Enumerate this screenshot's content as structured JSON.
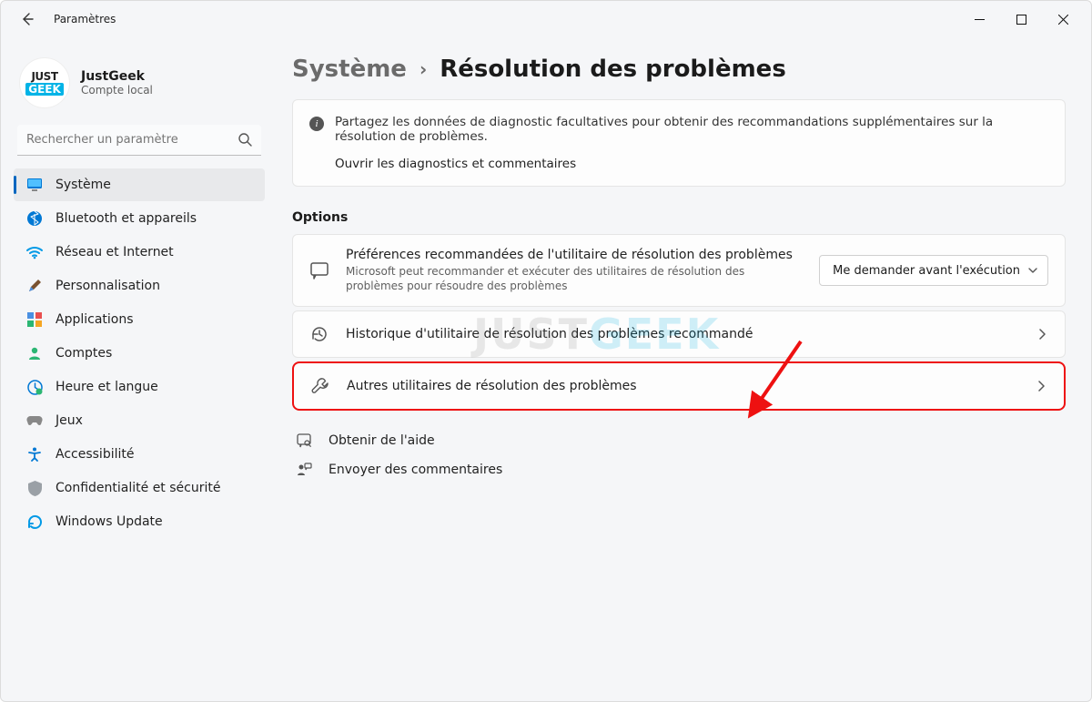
{
  "window": {
    "title": "Paramètres"
  },
  "user": {
    "name": "JustGeek",
    "subtitle": "Compte local",
    "avatar_line1": "JUST",
    "avatar_line2": "GEEK"
  },
  "search": {
    "placeholder": "Rechercher un paramètre"
  },
  "nav": {
    "items": [
      {
        "label": "Système",
        "icon": "monitor",
        "active": true
      },
      {
        "label": "Bluetooth et appareils",
        "icon": "bluetooth"
      },
      {
        "label": "Réseau et Internet",
        "icon": "wifi"
      },
      {
        "label": "Personnalisation",
        "icon": "brush"
      },
      {
        "label": "Applications",
        "icon": "apps"
      },
      {
        "label": "Comptes",
        "icon": "person"
      },
      {
        "label": "Heure et langue",
        "icon": "clock-globe"
      },
      {
        "label": "Jeux",
        "icon": "gamepad"
      },
      {
        "label": "Accessibilité",
        "icon": "accessibility"
      },
      {
        "label": "Confidentialité et sécurité",
        "icon": "shield"
      },
      {
        "label": "Windows Update",
        "icon": "update"
      }
    ]
  },
  "breadcrumb": {
    "parent": "Système",
    "current": "Résolution des problèmes"
  },
  "banner": {
    "text": "Partagez les données de diagnostic facultatives pour obtenir des recommandations supplémentaires sur la résolution de problèmes.",
    "link": "Ouvrir les diagnostics et commentaires"
  },
  "options_heading": "Options",
  "options": {
    "prefs": {
      "title": "Préférences recommandées de l'utilitaire de résolution des problèmes",
      "subtitle": "Microsoft peut recommander et exécuter des utilitaires de résolution des problèmes pour résoudre des problèmes",
      "dropdown_value": "Me demander avant l'exécution"
    },
    "history": {
      "title": "Historique d'utilitaire de résolution des problèmes recommandé"
    },
    "other": {
      "title": "Autres utilitaires de résolution des problèmes"
    }
  },
  "footer": {
    "help": "Obtenir de l'aide",
    "feedback": "Envoyer des commentaires"
  },
  "watermark": {
    "part1": "JUST",
    "part2": "GEEK"
  },
  "colors": {
    "accent": "#0067c0",
    "highlight": "#ee1111"
  }
}
